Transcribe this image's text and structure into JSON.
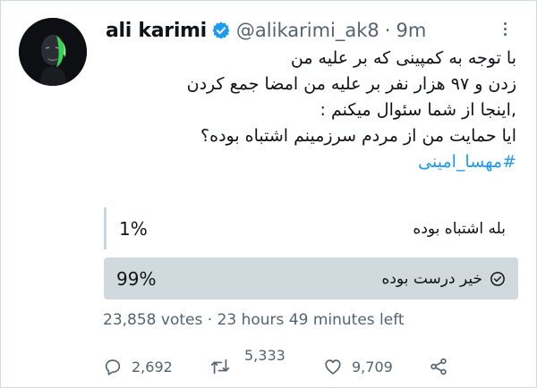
{
  "tweet": {
    "author_name": "ali karimi",
    "handle": "@alikarimi_ak8",
    "separator": "·",
    "time": "9m",
    "body_lines": [
      "با توجه به کمپینی که بر علیه من",
      "زدن و ۹۷ هزار نفر بر علیه من امضا جمع کردن",
      ",اینجا از شما سئوال میکنم :",
      "ایا حمایت من از مردم سرزمینم اشتباه بوده؟"
    ],
    "hashtag": "#مهسا_امینی"
  },
  "poll": {
    "options": [
      {
        "label": "بله اشتباه بوده",
        "percent": "1%",
        "selected": false
      },
      {
        "label": "خیر درست بوده",
        "percent": "99%",
        "selected": true
      }
    ],
    "votes": "23,858 votes",
    "time_left": "23 hours 49 minutes left"
  },
  "actions": {
    "replies": "2,692",
    "retweets": "5,333",
    "likes": "9,709"
  },
  "icons": [
    "verified-badge-icon",
    "more-icon",
    "check-circle-icon",
    "reply-icon",
    "retweet-icon",
    "like-icon",
    "share-icon"
  ],
  "colors": {
    "link": "#1d9bf0",
    "muted": "#536471",
    "winning_bar": "#cfd9de"
  }
}
